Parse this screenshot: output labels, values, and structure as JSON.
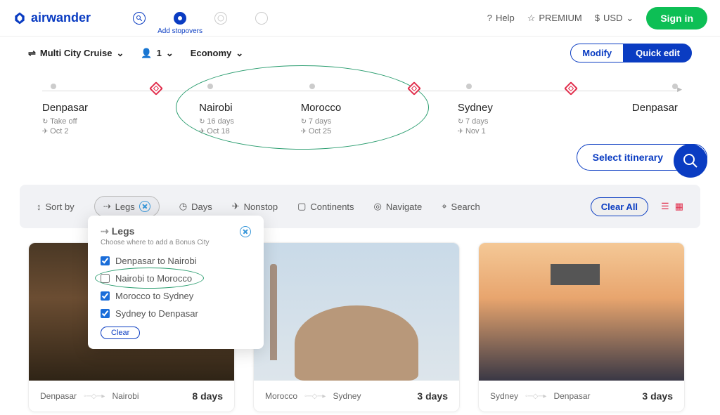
{
  "brand": "airwander",
  "header": {
    "step2_label": "Add stopovers",
    "help": "Help",
    "premium": "PREMIUM",
    "currency": "USD",
    "signin": "Sign in"
  },
  "options": {
    "trip_type": "Multi City Cruise",
    "passengers": "1",
    "cabin": "Economy",
    "modify": "Modify",
    "quick_edit": "Quick edit"
  },
  "itinerary": [
    {
      "name": "Denpasar",
      "sub": "Take off",
      "date": "Oct 2",
      "marker": "dot"
    },
    {
      "marker": "diamond"
    },
    {
      "name": "Nairobi",
      "sub": "16 days",
      "date": "Oct 18",
      "marker": "dot"
    },
    {
      "name": "Morocco",
      "sub": "7 days",
      "date": "Oct 25",
      "marker": "dot"
    },
    {
      "marker": "diamond"
    },
    {
      "name": "Sydney",
      "sub": "7 days",
      "date": "Nov 1",
      "marker": "dot"
    },
    {
      "marker": "diamond"
    },
    {
      "name": "Denpasar",
      "marker": "dot"
    }
  ],
  "select_label": "Select itinerary",
  "filters": {
    "sort": "Sort by",
    "legs": "Legs",
    "days": "Days",
    "nonstop": "Nonstop",
    "continents": "Continents",
    "navigate": "Navigate",
    "search": "Search",
    "clear_all": "Clear All"
  },
  "legs_popup": {
    "title": "Legs",
    "subtitle": "Choose where to add a Bonus City",
    "legs": [
      {
        "label": "Denpasar to Nairobi",
        "checked": true
      },
      {
        "label": "Nairobi to Morocco",
        "checked": false
      },
      {
        "label": "Morocco to Sydney",
        "checked": true
      },
      {
        "label": "Sydney to Denpasar",
        "checked": true
      }
    ],
    "clear": "Clear"
  },
  "cards": [
    {
      "from": "Denpasar",
      "to": "Nairobi",
      "days": "8 days"
    },
    {
      "from": "Morocco",
      "to": "Sydney",
      "days": "3 days"
    },
    {
      "from": "Sydney",
      "to": "Denpasar",
      "days": "3 days"
    }
  ]
}
